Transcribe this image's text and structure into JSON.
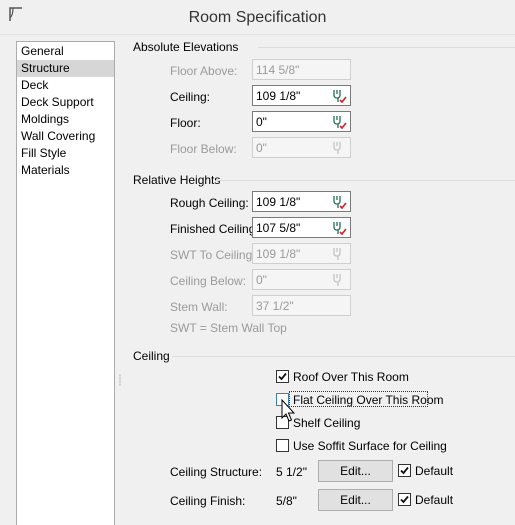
{
  "window": {
    "title": "Room Specification"
  },
  "nav": {
    "items": [
      {
        "label": "General"
      },
      {
        "label": "Structure"
      },
      {
        "label": "Deck"
      },
      {
        "label": "Deck Support"
      },
      {
        "label": "Moldings"
      },
      {
        "label": "Wall Covering"
      },
      {
        "label": "Fill Style"
      },
      {
        "label": "Materials"
      }
    ],
    "selected": "Structure"
  },
  "absolute_elevations": {
    "heading": "Absolute Elevations",
    "floor_above": {
      "label": "Floor Above:",
      "value": "114 5/8\""
    },
    "ceiling": {
      "label": "Ceiling:",
      "value": "109 1/8\""
    },
    "floor": {
      "label": "Floor:",
      "value": "0\""
    },
    "floor_below": {
      "label": "Floor Below:",
      "value": "0\""
    }
  },
  "relative_heights": {
    "heading": "Relative Heights",
    "rough_ceiling": {
      "label": "Rough Ceiling:",
      "value": "109 1/8\""
    },
    "finished_ceiling": {
      "label": "Finished Ceiling:",
      "value": "107 5/8\""
    },
    "swt_to_ceiling": {
      "label": "SWT To Ceiling:",
      "value": "109 1/8\""
    },
    "ceiling_below": {
      "label": "Ceiling Below:",
      "value": "0\""
    },
    "stem_wall": {
      "label": "Stem Wall:",
      "value": "37 1/2\""
    },
    "note": "SWT = Stem Wall Top"
  },
  "ceiling": {
    "heading": "Ceiling",
    "roof_over_room": {
      "label": "Roof Over This Room",
      "checked": true
    },
    "flat_ceiling": {
      "label": "Flat Ceiling Over This Room",
      "checked": false
    },
    "shelf_ceiling": {
      "label": "Shelf Ceiling",
      "checked": false
    },
    "soffit_surface": {
      "label": "Use Soffit Surface for Ceiling",
      "checked": false
    },
    "structure": {
      "label": "Ceiling Structure:",
      "value": "5 1/2\"",
      "button": "Edit...",
      "default_label": "Default",
      "default_checked": true
    },
    "finish": {
      "label": "Ceiling Finish:",
      "value": "5/8\"",
      "button": "Edit...",
      "default_label": "Default",
      "default_checked": true
    }
  },
  "colors": {
    "accent_check": "#d0202a",
    "calc_icon": "#1f6e5a",
    "focus_border": "#3c7fb1"
  },
  "icons": {
    "calculator": "calculator-icon",
    "checkmark": "checkmark-icon"
  }
}
